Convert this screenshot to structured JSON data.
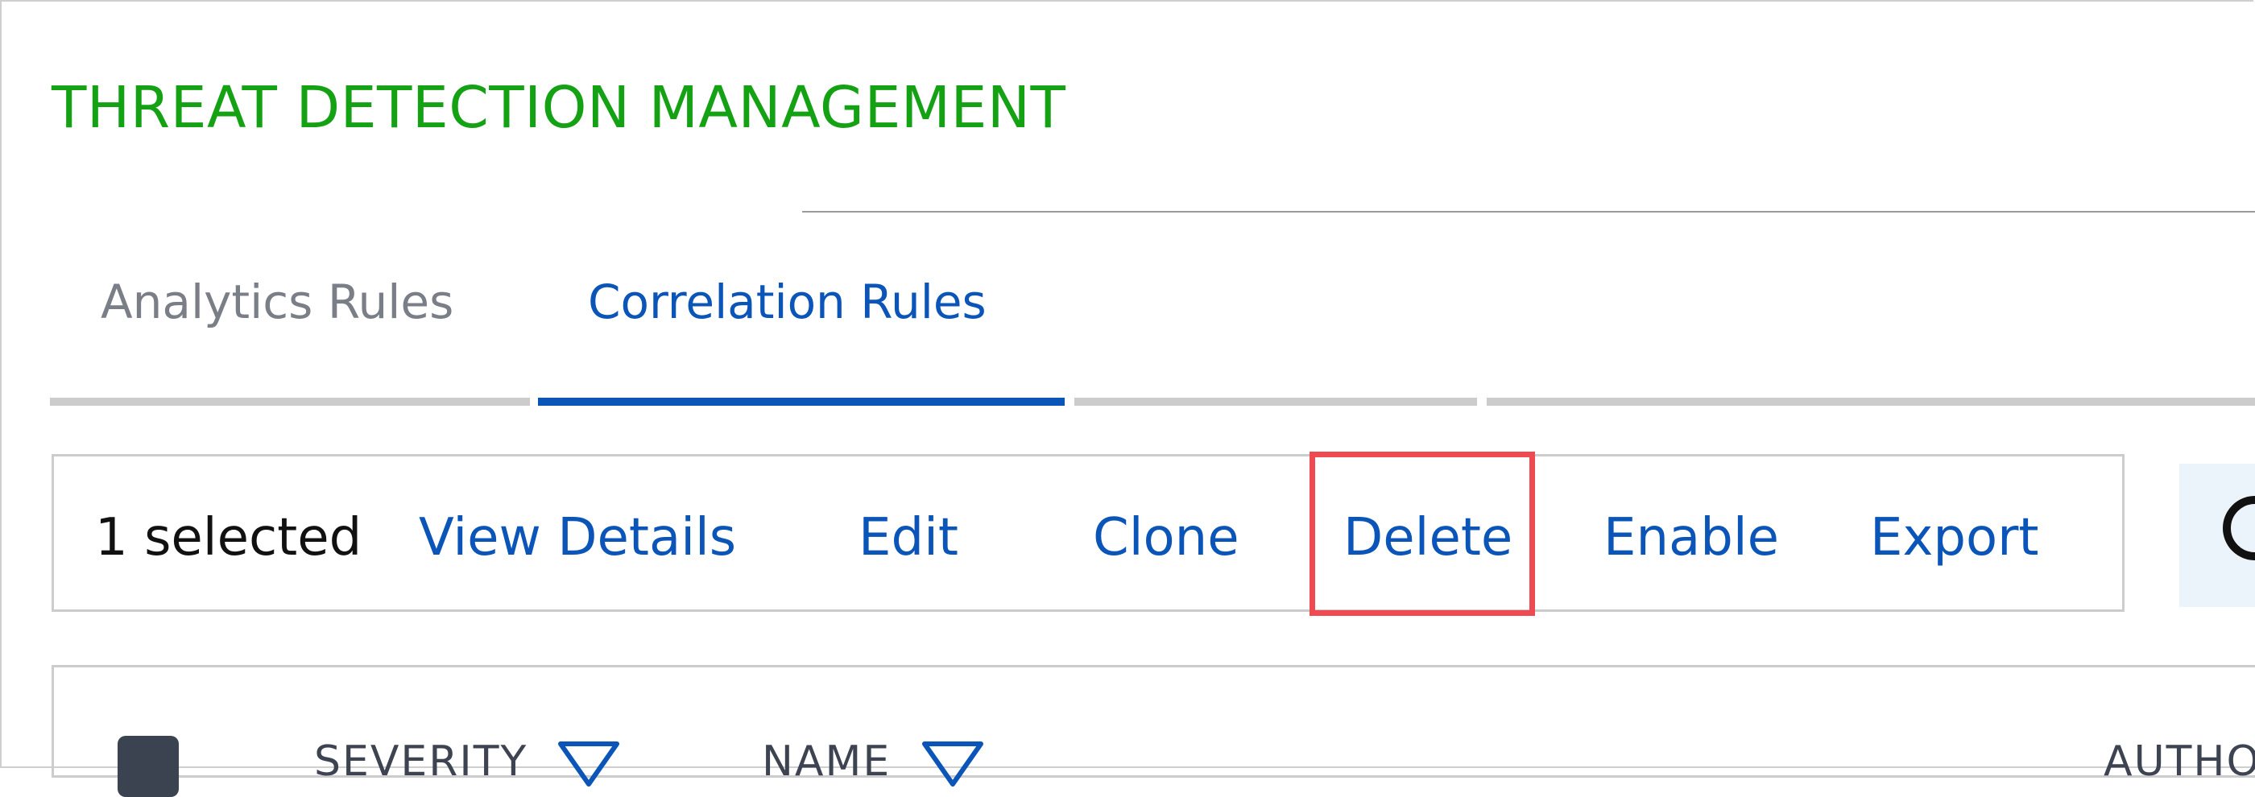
{
  "header": {
    "title": "THREAT DETECTION MANAGEMENT"
  },
  "tabs": [
    {
      "label": "Analytics Rules",
      "active": false
    },
    {
      "label": "Correlation Rules",
      "active": true
    }
  ],
  "action_bar": {
    "selected_count": "1 selected",
    "actions": [
      "View Details",
      "Edit",
      "Clone",
      "Delete",
      "Enable",
      "Export"
    ],
    "highlighted_action": "Delete"
  },
  "table": {
    "columns": [
      "SEVERITY",
      "NAME",
      "AUTHOR"
    ]
  },
  "icons": {
    "filter": "filter-icon",
    "search": "search-icon"
  },
  "colors": {
    "title": "#14a214",
    "accent": "#0b55b8",
    "highlight": "#ef4a52",
    "inactive_tab": "#7a7e87"
  }
}
